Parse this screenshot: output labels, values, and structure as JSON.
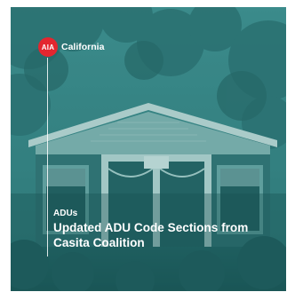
{
  "brand": {
    "logo_text": "AIA",
    "name": "California",
    "logo_color": "#e3262f"
  },
  "card": {
    "tint_color": "#2f7f80",
    "category": "ADUs",
    "title": "Updated ADU Code Sections from Casita Coalition"
  },
  "icons": {
    "brand_mark": "aia-logo-icon"
  }
}
